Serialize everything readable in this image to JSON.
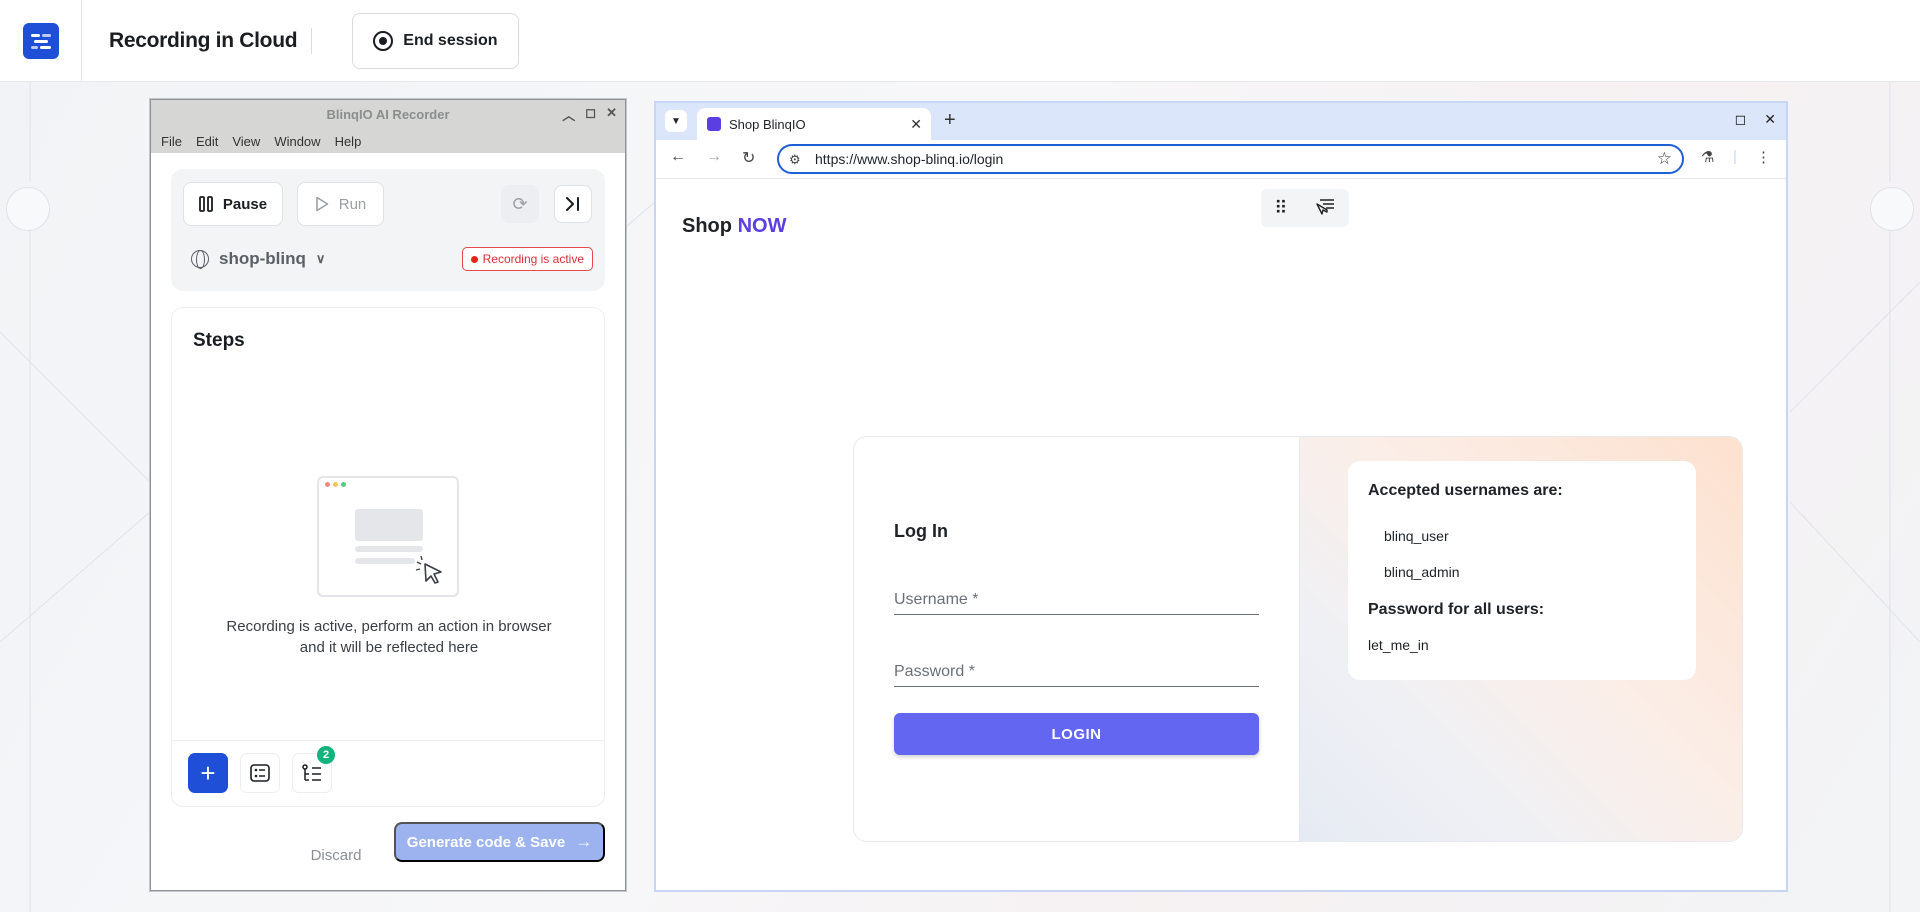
{
  "topbar": {
    "title": "Recording in Cloud",
    "end_session_label": "End session",
    "logo_icon": "app-logo-icon"
  },
  "recorder": {
    "window_title": "BlinqIO AI Recorder",
    "menu": [
      "File",
      "Edit",
      "View",
      "Window",
      "Help"
    ],
    "pause_label": "Pause",
    "run_label": "Run",
    "project_name": "shop-blinq",
    "status_badge": "Recording is active",
    "steps_title": "Steps",
    "empty_message": "Recording is active, perform an action in browser and it will be reflected here",
    "step_count": "2",
    "discard_label": "Discard",
    "generate_label": "Generate code & Save"
  },
  "browser": {
    "tab_title": "Shop BlinqIO",
    "url": "https://www.shop-blinq.io/login"
  },
  "site": {
    "brand_shop": "Shop",
    "brand_now": "NOW",
    "login_title": "Log In",
    "username_placeholder": "Username *",
    "password_placeholder": "Password *",
    "login_button": "LOGIN",
    "accepted_heading": "Accepted usernames are:",
    "usernames": [
      "blinq_user",
      "blinq_admin"
    ],
    "password_heading": "Password for all users:",
    "password_value": "let_me_in"
  },
  "colors": {
    "accent_blue": "#1e4fd6",
    "brand_purple": "#5b3fe0",
    "login_button": "#6366f1",
    "recording_red": "#e5251a",
    "badge_green": "#14b37d"
  }
}
